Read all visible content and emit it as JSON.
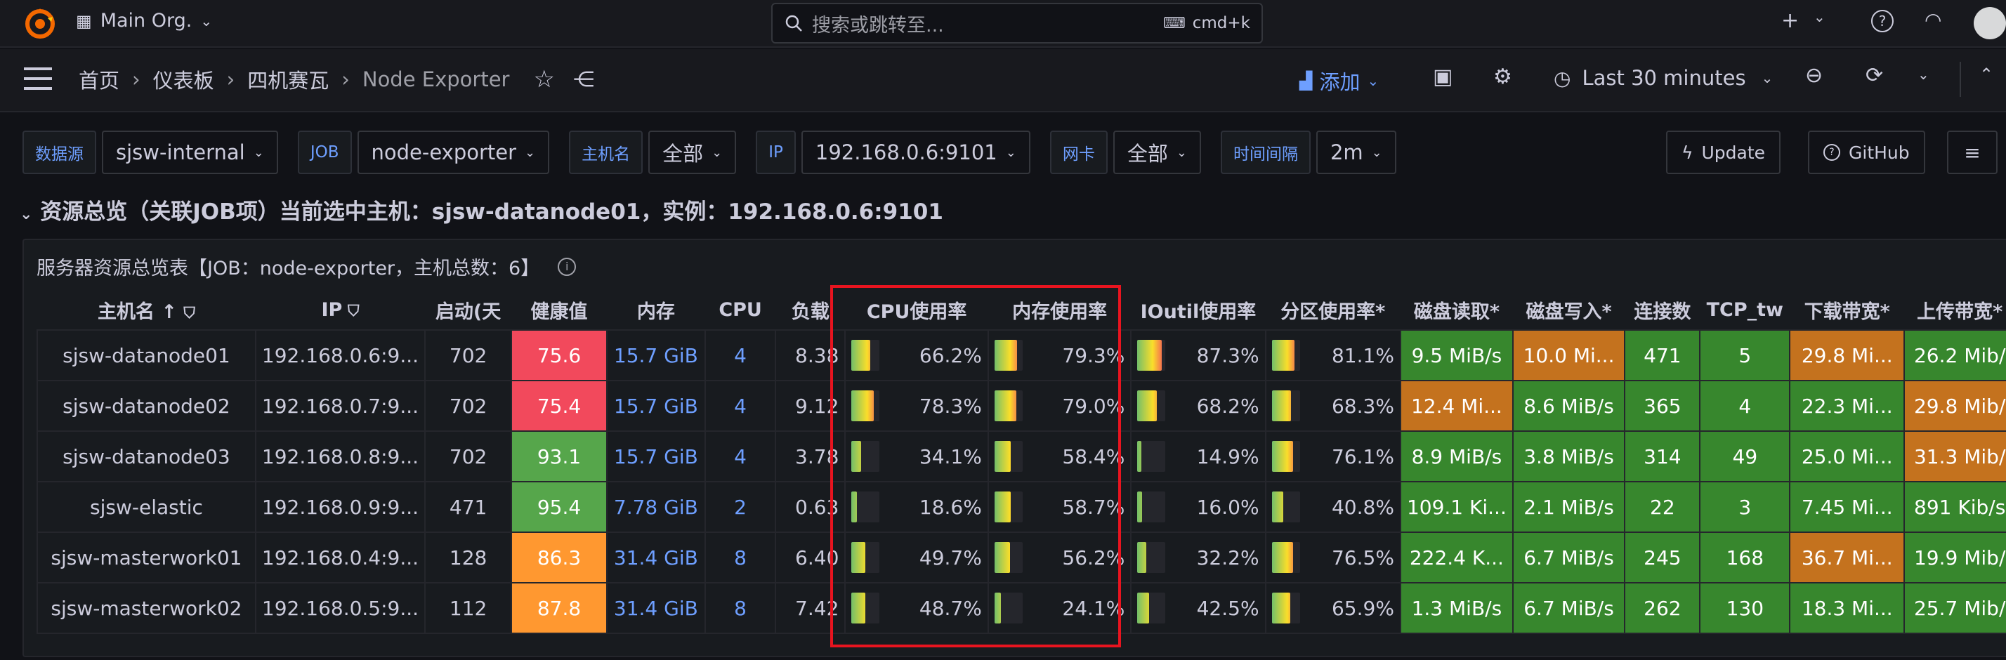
{
  "topbar": {
    "org": "Main Org.",
    "search_placeholder": "搜索或跳转至...",
    "shortcut": "cmd+k"
  },
  "breadcrumb": [
    "首页",
    "仪表板",
    "四机赛瓦",
    "Node Exporter"
  ],
  "toolbar": {
    "add_label": "添加",
    "time_range": "Last 30 minutes"
  },
  "variables": [
    {
      "label": "数据源",
      "value": "sjsw-internal"
    },
    {
      "label": "JOB",
      "value": "node-exporter"
    },
    {
      "label": "主机名",
      "value": "全部"
    },
    {
      "label": "IP",
      "value": "192.168.0.6:9101"
    },
    {
      "label": "网卡",
      "value": "全部"
    },
    {
      "label": "时间间隔",
      "value": "2m"
    }
  ],
  "links": {
    "update": "Update",
    "github": "GitHub"
  },
  "row_title": "资源总览（关联JOB项）当前选中主机：sjsw-datanode01，实例：192.168.0.6:9101",
  "panel": {
    "title": "服务器资源总览表【JOB：node-exporter，主机总数：6】",
    "columns": [
      "主机名",
      "IP",
      "启动(天",
      "健康值",
      "内存",
      "CPU",
      "负载",
      "CPU使用率",
      "内存使用率",
      "IOutil使用率",
      "分区使用率*",
      "磁盘读取*",
      "磁盘写入*",
      "连接数",
      "TCP_tw",
      "下载带宽*",
      "上传带宽*"
    ],
    "rows": [
      {
        "host": "sjsw-datanode01",
        "ip": "192.168.0.6:9...",
        "uptime": "702",
        "health": "75.6",
        "health_color": "#f2495c",
        "mem": "15.7 GiB",
        "cpu": "4",
        "load": "8.38",
        "cpu_use": "66.2%",
        "cpu_frac": 0.662,
        "mem_use": "79.3%",
        "mem_frac": 0.793,
        "io": "87.3%",
        "io_frac": 0.873,
        "part": "81.1%",
        "part_frac": 0.811,
        "dread": "9.5 MiB/s",
        "dread_color": "#37872d",
        "dwrite": "10.0 Mi...",
        "dwrite_color": "#c4721e",
        "conn": "471",
        "tcp": "5",
        "down": "29.8 Mi...",
        "down_color": "#c4721e",
        "up": "26.2 Mib/",
        "up_color": "#37872d"
      },
      {
        "host": "sjsw-datanode02",
        "ip": "192.168.0.7:9...",
        "uptime": "702",
        "health": "75.4",
        "health_color": "#f2495c",
        "mem": "15.7 GiB",
        "cpu": "4",
        "load": "9.12",
        "cpu_use": "78.3%",
        "cpu_frac": 0.783,
        "mem_use": "79.0%",
        "mem_frac": 0.79,
        "io": "68.2%",
        "io_frac": 0.682,
        "part": "68.3%",
        "part_frac": 0.683,
        "dread": "12.4 Mi...",
        "dread_color": "#c4721e",
        "dwrite": "8.6 MiB/s",
        "dwrite_color": "#37872d",
        "conn": "365",
        "tcp": "4",
        "down": "22.3 Mi...",
        "down_color": "#37872d",
        "up": "29.8 Mib/",
        "up_color": "#c4721e"
      },
      {
        "host": "sjsw-datanode03",
        "ip": "192.168.0.8:9...",
        "uptime": "702",
        "health": "93.1",
        "health_color": "#56a64b",
        "mem": "15.7 GiB",
        "cpu": "4",
        "load": "3.78",
        "cpu_use": "34.1%",
        "cpu_frac": 0.341,
        "mem_use": "58.4%",
        "mem_frac": 0.584,
        "io": "14.9%",
        "io_frac": 0.149,
        "part": "76.1%",
        "part_frac": 0.761,
        "dread": "8.9 MiB/s",
        "dread_color": "#37872d",
        "dwrite": "3.8 MiB/s",
        "dwrite_color": "#37872d",
        "conn": "314",
        "tcp": "49",
        "down": "25.0 Mi...",
        "down_color": "#37872d",
        "up": "31.3 Mib/",
        "up_color": "#c4721e"
      },
      {
        "host": "sjsw-elastic",
        "ip": "192.168.0.9:9...",
        "uptime": "471",
        "health": "95.4",
        "health_color": "#56a64b",
        "mem": "7.78 GiB",
        "cpu": "2",
        "load": "0.63",
        "cpu_use": "18.6%",
        "cpu_frac": 0.186,
        "mem_use": "58.7%",
        "mem_frac": 0.587,
        "io": "16.0%",
        "io_frac": 0.16,
        "part": "40.8%",
        "part_frac": 0.408,
        "dread": "109.1 Ki...",
        "dread_color": "#37872d",
        "dwrite": "2.1 MiB/s",
        "dwrite_color": "#37872d",
        "conn": "22",
        "tcp": "3",
        "down": "7.45 Mi...",
        "down_color": "#37872d",
        "up": "891 Kib/s",
        "up_color": "#37872d"
      },
      {
        "host": "sjsw-masterwork01",
        "ip": "192.168.0.4:9...",
        "uptime": "128",
        "health": "86.3",
        "health_color": "#ff9830",
        "mem": "31.4 GiB",
        "cpu": "8",
        "load": "6.40",
        "cpu_use": "49.7%",
        "cpu_frac": 0.497,
        "mem_use": "56.2%",
        "mem_frac": 0.562,
        "io": "32.2%",
        "io_frac": 0.322,
        "part": "76.5%",
        "part_frac": 0.765,
        "dread": "222.4 K...",
        "dread_color": "#37872d",
        "dwrite": "6.7 MiB/s",
        "dwrite_color": "#37872d",
        "conn": "245",
        "tcp": "168",
        "down": "36.7 Mi...",
        "down_color": "#c4721e",
        "up": "19.9 Mib/",
        "up_color": "#37872d"
      },
      {
        "host": "sjsw-masterwork02",
        "ip": "192.168.0.5:9...",
        "uptime": "112",
        "health": "87.8",
        "health_color": "#ff9830",
        "mem": "31.4 GiB",
        "cpu": "8",
        "load": "7.42",
        "cpu_use": "48.7%",
        "cpu_frac": 0.487,
        "mem_use": "24.1%",
        "mem_frac": 0.241,
        "io": "42.5%",
        "io_frac": 0.425,
        "part": "65.9%",
        "part_frac": 0.659,
        "dread": "1.3 MiB/s",
        "dread_color": "#37872d",
        "dwrite": "6.7 MiB/s",
        "dwrite_color": "#37872d",
        "conn": "262",
        "tcp": "130",
        "down": "18.3 Mi...",
        "down_color": "#37872d",
        "up": "25.7 Mib/",
        "up_color": "#37872d"
      }
    ]
  },
  "colors": {
    "accent": "#6e9fff",
    "highlight_box": "#e8141f",
    "cell_green": "#37872d",
    "cell_orange": "#c4721e"
  }
}
